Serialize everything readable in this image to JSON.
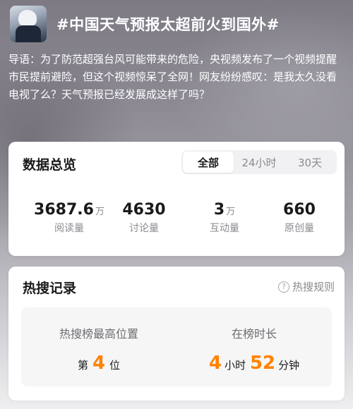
{
  "topic": {
    "title": "#中国天气预报太超前火到国外#",
    "intro": "导语：为了防范超强台风可能带来的危险，央视频发布了一个视频提醒市民提前避险，但这个视频惊呆了全网！网友纷纷感叹：是我太久没看电视了么？天气预报已经发展成这样了吗？"
  },
  "overview": {
    "title": "数据总览",
    "tabs": [
      "全部",
      "24小时",
      "30天"
    ],
    "active_tab": "全部",
    "stats": [
      {
        "value": "3687.6",
        "unit": "万",
        "label": "阅读量"
      },
      {
        "value": "4630",
        "unit": "",
        "label": "讨论量"
      },
      {
        "value": "3",
        "unit": "万",
        "label": "互动量"
      },
      {
        "value": "660",
        "unit": "",
        "label": "原创量"
      }
    ]
  },
  "hot": {
    "title": "热搜记录",
    "rules_label": "热搜规则",
    "rules_icon": "question-circle-icon",
    "peak": {
      "heading": "热搜榜最高位置",
      "prefix": "第",
      "value": "4",
      "suffix": "位"
    },
    "duration": {
      "heading": "在榜时长",
      "hours": "4",
      "hours_unit": "小时",
      "minutes": "52",
      "minutes_unit": "分钟"
    }
  },
  "colors": {
    "accent": "#ff8200",
    "text": "#1a1a1a",
    "muted": "#8a8a8f"
  }
}
